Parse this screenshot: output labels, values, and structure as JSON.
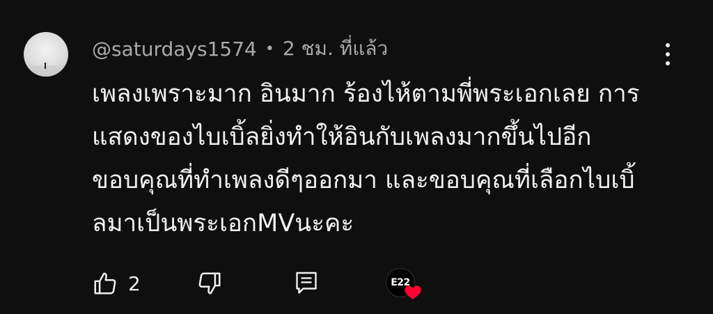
{
  "comment": {
    "author": "@saturdays1574",
    "separator": "•",
    "time": "2 ชม. ที่แล้ว",
    "text_lines": [
      "เพลงเพราะมาก อินมาก ร้องไห้ตามพี่พระเอกเลย การ",
      "แสดงของไบเบิ้ลยิ่งทำให้อินกับเพลงมากขึ้นไปอีก",
      "ขอบคุณที่ทำเพลงดีๆออกมา และขอบคุณที่เลือกไบเบิ้",
      "ลมาเป็นพระเอกMVนะคะ"
    ],
    "like_count": "2",
    "creator_badge_text": "E22"
  },
  "icons": {
    "more": "more-vert-icon",
    "like": "thumbs-up-icon",
    "dislike": "thumbs-down-icon",
    "reply": "reply-comment-icon",
    "heart": "heart-icon"
  },
  "colors": {
    "background": "#0f0f0f",
    "text": "#f1f1f1",
    "meta": "#aaaaaa",
    "heart": "#ff0033"
  }
}
